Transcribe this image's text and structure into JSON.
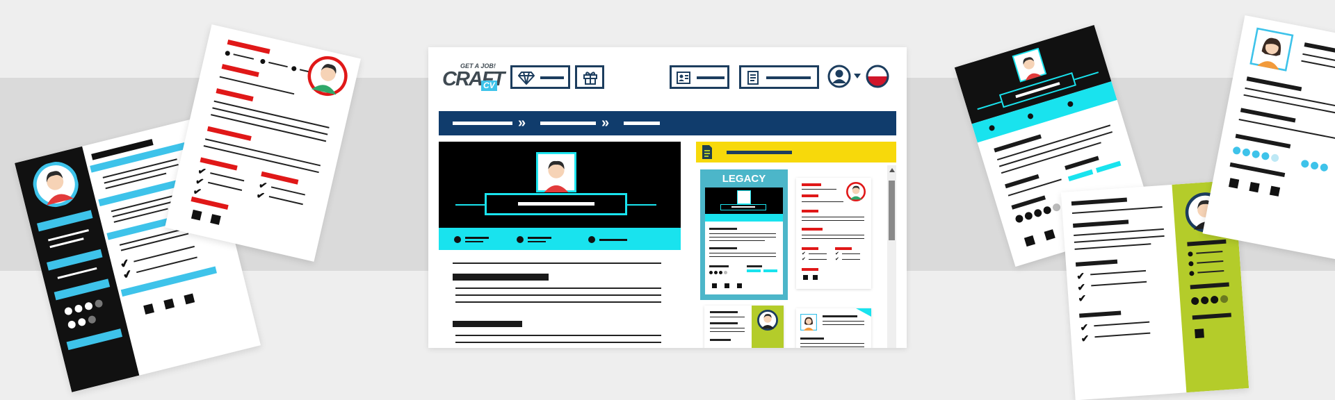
{
  "brand": {
    "tagline": "GET A JOB!",
    "logo_letters": "CRAFT",
    "logo_suffix": "CV"
  },
  "template_panel": {
    "featured_label": "LEGACY"
  },
  "colors": {
    "navy": "#103c6c",
    "cyan": "#19e3ee",
    "yellow": "#f7d90b",
    "red": "#e01818",
    "sky": "#3ec3ea",
    "lime": "#b4cc2a",
    "teal_frame": "#4cb6c9"
  },
  "icons": {
    "premium": "diamond-icon",
    "gift": "gift-icon",
    "resume": "id-card-icon",
    "document": "document-icon",
    "account": "user-avatar-icon",
    "language": "flag-icon"
  }
}
